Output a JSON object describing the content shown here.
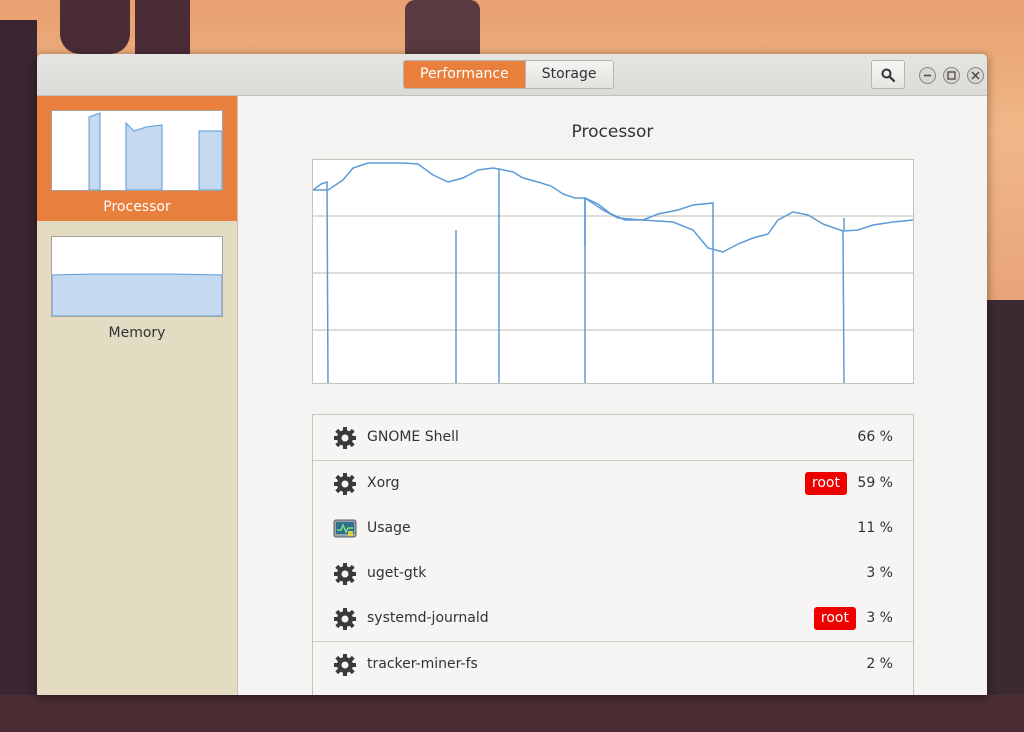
{
  "header": {
    "tabs": [
      {
        "label": "Performance",
        "active": true
      },
      {
        "label": "Storage",
        "active": false
      }
    ],
    "search_icon": "search-icon",
    "window_controls": [
      "minimize-icon",
      "maximize-icon",
      "close-icon"
    ]
  },
  "sidebar": {
    "items": [
      {
        "label": "Processor",
        "selected": true
      },
      {
        "label": "Memory",
        "selected": false
      }
    ]
  },
  "main": {
    "title": "Processor"
  },
  "processes": [
    {
      "name": "GNOME Shell",
      "percent": "66 %",
      "badge": "",
      "icon": "gear-icon"
    },
    {
      "name": "Xorg",
      "percent": "59 %",
      "badge": "root",
      "icon": "gear-icon"
    },
    {
      "name": "Usage",
      "percent": "11 %",
      "badge": "",
      "icon": "usage-app-icon"
    },
    {
      "name": "uget-gtk",
      "percent": "3 %",
      "badge": "",
      "icon": "gear-icon"
    },
    {
      "name": "systemd-journald",
      "percent": "3 %",
      "badge": "root",
      "icon": "gear-icon"
    },
    {
      "name": "tracker-miner-fs",
      "percent": "2 %",
      "badge": "",
      "icon": "gear-icon"
    }
  ],
  "colors": {
    "accent": "#e97f3c",
    "graph_line": "#5b9bd8",
    "badge": "#ee0000"
  }
}
